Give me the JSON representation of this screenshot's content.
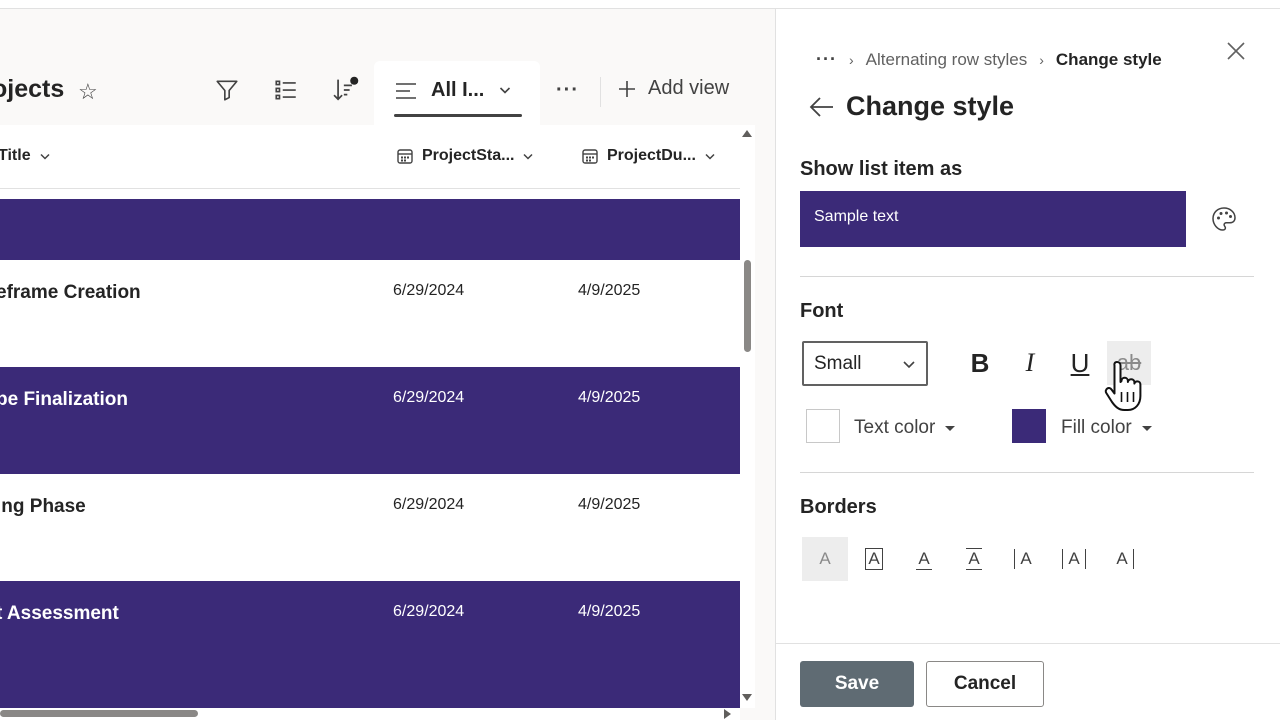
{
  "list": {
    "title": "ojects",
    "view": {
      "label": "All I..."
    },
    "add_view_label": "Add view",
    "more_label": "···",
    "columns": [
      {
        "label": "Title"
      },
      {
        "label": "ProjectSta..."
      },
      {
        "label": "ProjectDu..."
      }
    ],
    "rows": [
      {
        "title": "",
        "start": "",
        "due": "",
        "style": "band"
      },
      {
        "title": "eframe Creation",
        "start": "6/29/2024",
        "due": "4/9/2025",
        "style": "plain"
      },
      {
        "title": "pe Finalization",
        "start": "6/29/2024",
        "due": "4/9/2025",
        "style": "band"
      },
      {
        "title": "ing Phase",
        "start": "6/29/2024",
        "due": "4/9/2025",
        "style": "plain"
      },
      {
        "title": "t Assessment",
        "start": "6/29/2024",
        "due": "4/9/2025",
        "style": "band"
      }
    ]
  },
  "panel": {
    "breadcrumb": {
      "dots": "···",
      "parent": "Alternating row styles",
      "current": "Change style"
    },
    "title": "Change style",
    "show_as_label": "Show list item as",
    "sample_text": "Sample text",
    "font_label": "Font",
    "font_size": "Small",
    "format_buttons": {
      "bold": "B",
      "italic": "I",
      "underline": "U",
      "strike": "ab"
    },
    "text_color_label": "Text color",
    "fill_color_label": "Fill color",
    "borders_label": "Borders",
    "border_glyph": "A",
    "save_label": "Save",
    "cancel_label": "Cancel"
  },
  "colors": {
    "band_fill": "#3b2a78",
    "text_color_swatch": "#ffffff",
    "save_button": "#5f6b73"
  },
  "icons": [
    "star-icon",
    "filter-icon",
    "details-list-icon",
    "sort-icon",
    "view-lines-icon",
    "chevron-down-icon",
    "plus-icon",
    "calendar-icon",
    "close-icon",
    "back-arrow-icon",
    "palette-icon",
    "hand-cursor-icon"
  ]
}
